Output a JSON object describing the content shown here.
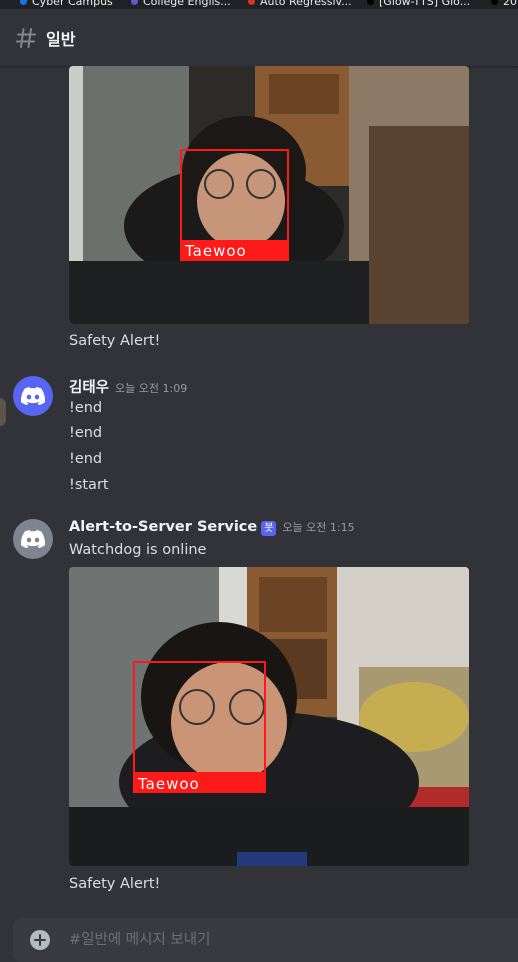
{
  "bookmarks": [
    {
      "label": "Cyber Campus",
      "color": "#1a73e8"
    },
    {
      "label": "College Englis...",
      "color": "#5b5bd6"
    },
    {
      "label": "Auto Regressiv...",
      "color": "#d93025"
    },
    {
      "label": "[Glow-TTS] Glo...",
      "color": "#202124"
    },
    {
      "label": "20",
      "color": "#202124"
    }
  ],
  "channel": {
    "icon": "hash-icon",
    "name": "일반"
  },
  "messages": [
    {
      "attachment_label": "Taewoo",
      "text": "Safety Alert!"
    },
    {
      "author": "김태우",
      "avatar_color": "#5865f2",
      "timestamp": "오늘 오전 1:09",
      "lines": [
        "!end",
        "!end",
        "!end",
        "!start"
      ]
    },
    {
      "author": "Alert-to-Server Service",
      "bot_badge": "봇",
      "avatar_color": "#80848e",
      "timestamp": "오늘 오전 1:15",
      "text": "Watchdog is online",
      "attachment_label": "Taewoo",
      "caption": "Safety Alert!"
    }
  ],
  "composer": {
    "placeholder": "#일반에 메시지 보내기"
  },
  "colors": {
    "background": "#313338",
    "accent": "#5865f2",
    "alert_box": "#ff1a1a"
  }
}
